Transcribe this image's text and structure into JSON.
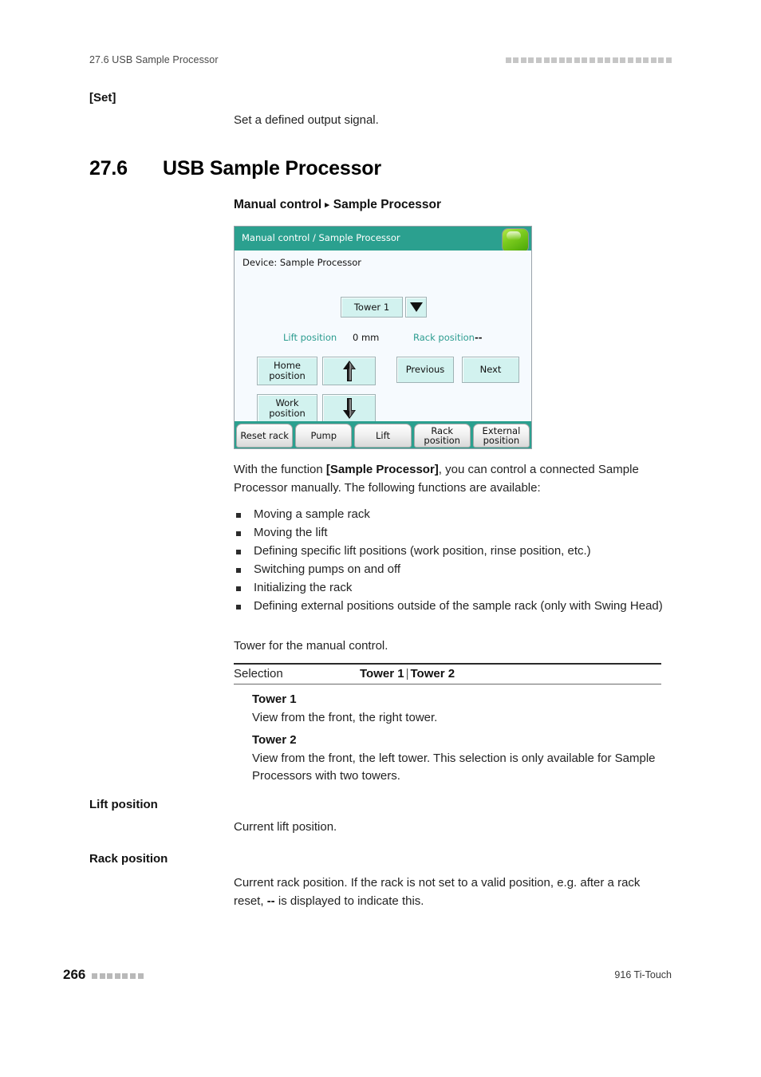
{
  "header": {
    "running_head": "27.6 USB Sample Processor",
    "marker_count": 22
  },
  "set_block": {
    "label": "[Set]",
    "description": "Set a defined output signal."
  },
  "section": {
    "number": "27.6",
    "title": "USB Sample Processor"
  },
  "breadcrumb": {
    "first": "Manual control",
    "arrow": "▸",
    "second": "Sample Processor"
  },
  "device_screen": {
    "title": "Manual control / Sample Processor",
    "status_led": "green-status-led",
    "device_line": "Device: Sample Processor",
    "tower_selected": "Tower 1",
    "dropdown_icon": "caret-down-icon",
    "lift_position_label": "Lift position",
    "lift_position_value": "0  mm",
    "rack_position_label": "Rack position",
    "rack_position_value": "--",
    "buttons": {
      "home": "Home\nposition",
      "home_line1": "Home",
      "home_line2": "position",
      "work_line1": "Work",
      "work_line2": "position",
      "up_icon": "arrow-up-icon",
      "down_icon": "arrow-down-icon",
      "previous": "Previous",
      "next": "Next"
    },
    "tabs": [
      {
        "line1": "Reset rack",
        "line2": ""
      },
      {
        "line1": "Pump",
        "line2": ""
      },
      {
        "line1": "Lift",
        "line2": ""
      },
      {
        "line1": "Rack",
        "line2": "position"
      },
      {
        "line1": "External",
        "line2": "position"
      }
    ],
    "colors": {
      "title_bar": "#2ba08f",
      "panel_bg": "#f6fafe",
      "button_face": "#d2f2ef",
      "label_teal": "#2c9c90"
    }
  },
  "intro": {
    "line_pre": "With the function ",
    "bold": "[Sample Processor]",
    "line_post": ", you can control a connected Sample Processor manually. The following functions are available:"
  },
  "bullets": [
    "Moving a sample rack",
    "Moving the lift",
    "Defining specific lift positions (work position, rinse position, etc.)",
    "Switching pumps on and off",
    "Initializing the rack",
    "Defining external positions outside of the sample rack (only with Swing Head)"
  ],
  "tower_intro": "Tower for the manual control.",
  "selection_table": {
    "key": "Selection",
    "value_a": "Tower 1",
    "separator": "|",
    "value_b": "Tower 2"
  },
  "tower_defs": [
    {
      "term": "Tower 1",
      "text": "View from the front, the right tower."
    },
    {
      "term": "Tower 2",
      "text": "View from the front, the left tower. This selection is only available for Sample Processors with two towers."
    }
  ],
  "lift_position_block": {
    "label": "Lift position",
    "description": "Current lift position."
  },
  "rack_position_block": {
    "label": "Rack position",
    "description_pre": "Current rack position. If the rack is not set to a valid position, e.g. after a rack reset, ",
    "description_mark": "--",
    "description_post": " is displayed to indicate this."
  },
  "footer": {
    "page_number": "266",
    "marker_count": 7,
    "right_text": "916 Ti-Touch"
  }
}
